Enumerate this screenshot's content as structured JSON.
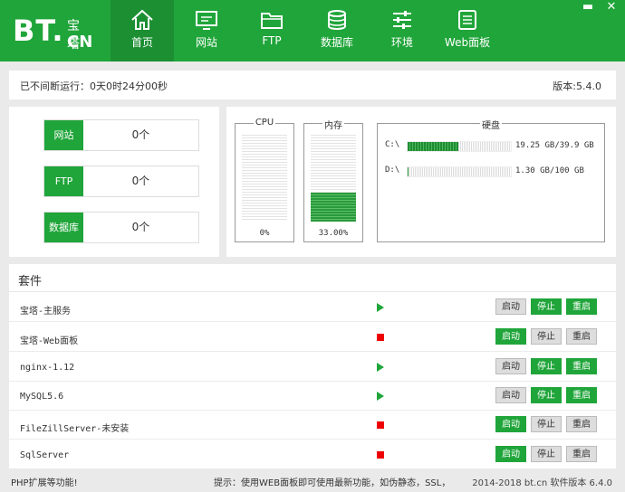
{
  "logo": {
    "main": "BT.",
    "cn": "宝塔",
    "en": "CN"
  },
  "nav": [
    {
      "label": "首页",
      "icon": "home-icon",
      "active": true
    },
    {
      "label": "网站",
      "icon": "monitor-icon"
    },
    {
      "label": "FTP",
      "icon": "folder-icon"
    },
    {
      "label": "数据库",
      "icon": "database-icon"
    },
    {
      "label": "环境",
      "icon": "sliders-icon"
    },
    {
      "label": "Web面板",
      "icon": "panel-icon"
    }
  ],
  "window": {
    "minimize": "▬",
    "close": "✕"
  },
  "status": {
    "running": "已不间断运行：0天0时24分00秒",
    "version": "版本:5.4.0"
  },
  "stats": [
    {
      "label": "网站",
      "value": "0个"
    },
    {
      "label": "FTP",
      "value": "0个"
    },
    {
      "label": "数据库",
      "value": "0个"
    }
  ],
  "resources": {
    "cpu": {
      "title": "CPU",
      "percent": 0,
      "label": "0%"
    },
    "mem": {
      "title": "内存",
      "percent": 33,
      "label": "33.00%"
    },
    "disk": {
      "title": "硬盘",
      "drives": [
        {
          "name": "C:\\",
          "fraction": 0.49,
          "size": "19.25 GB/39.9 GB"
        },
        {
          "name": "D:\\",
          "fraction": 0.013,
          "size": "1.30 GB/100 GB"
        }
      ]
    }
  },
  "plugins": {
    "title": "套件",
    "buttons": {
      "start": "启动",
      "stop": "停止",
      "restart": "重启"
    },
    "items": [
      {
        "name": "宝塔-主服务",
        "running": true
      },
      {
        "name": "宝塔-Web面板",
        "running": false
      },
      {
        "name": "nginx-1.12",
        "running": true
      },
      {
        "name": "MySQL5.6",
        "running": true
      },
      {
        "name": "FileZillServer-未安装",
        "running": false
      },
      {
        "name": "SqlServer",
        "running": false
      }
    ]
  },
  "footer": {
    "left": "PHP扩展等功能!",
    "tip": "提示：使用WEB面板即可使用最新功能，如伪静态，SSL，",
    "copyright": "2014-2018 bt.cn  软件版本 6.4.0"
  },
  "colors": {
    "brand": "#20a53a",
    "brand_dark": "#1c8f33",
    "stopped": "#ee0000"
  }
}
